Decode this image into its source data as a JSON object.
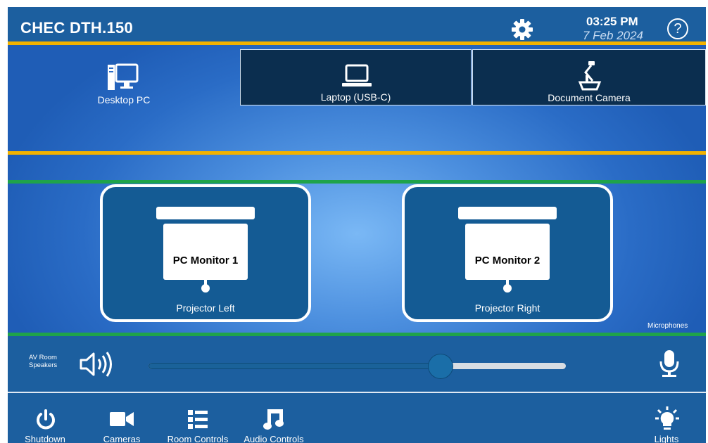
{
  "header": {
    "room_name": "CHEC DTH.150",
    "time": "03:25 PM",
    "date": "7 Feb 2024",
    "help_label": "?"
  },
  "sources": [
    {
      "label": "Desktop PC",
      "icon": "desktop-pc-icon",
      "active": true
    },
    {
      "label": "Laptop (USB-C)",
      "icon": "laptop-icon",
      "active": false
    },
    {
      "label": "Document Camera",
      "icon": "document-camera-icon",
      "active": false
    }
  ],
  "displays": [
    {
      "name": "PC Monitor 1",
      "location": "Projector Left"
    },
    {
      "name": "PC Monitor 2",
      "location": "Projector Right"
    }
  ],
  "audio": {
    "speakers_label_line1": "AV Room",
    "speakers_label_line2": "Speakers",
    "microphones_label": "Microphones",
    "volume_fraction": 0.7
  },
  "nav": [
    {
      "label": "Shutdown",
      "icon": "power-icon"
    },
    {
      "label": "Cameras",
      "icon": "video-camera-icon"
    },
    {
      "label": "Room Controls",
      "icon": "list-icon"
    },
    {
      "label": "Audio Controls",
      "icon": "music-note-icon"
    },
    {
      "label": "Lights",
      "icon": "light-bulb-icon"
    }
  ],
  "colors": {
    "header_bg": "#1c5f9f",
    "accent_orange": "#f2b200",
    "accent_green": "#1fa34a",
    "tab_inactive_bg": "#0b2e4f",
    "display_card_bg": "#145b94"
  }
}
